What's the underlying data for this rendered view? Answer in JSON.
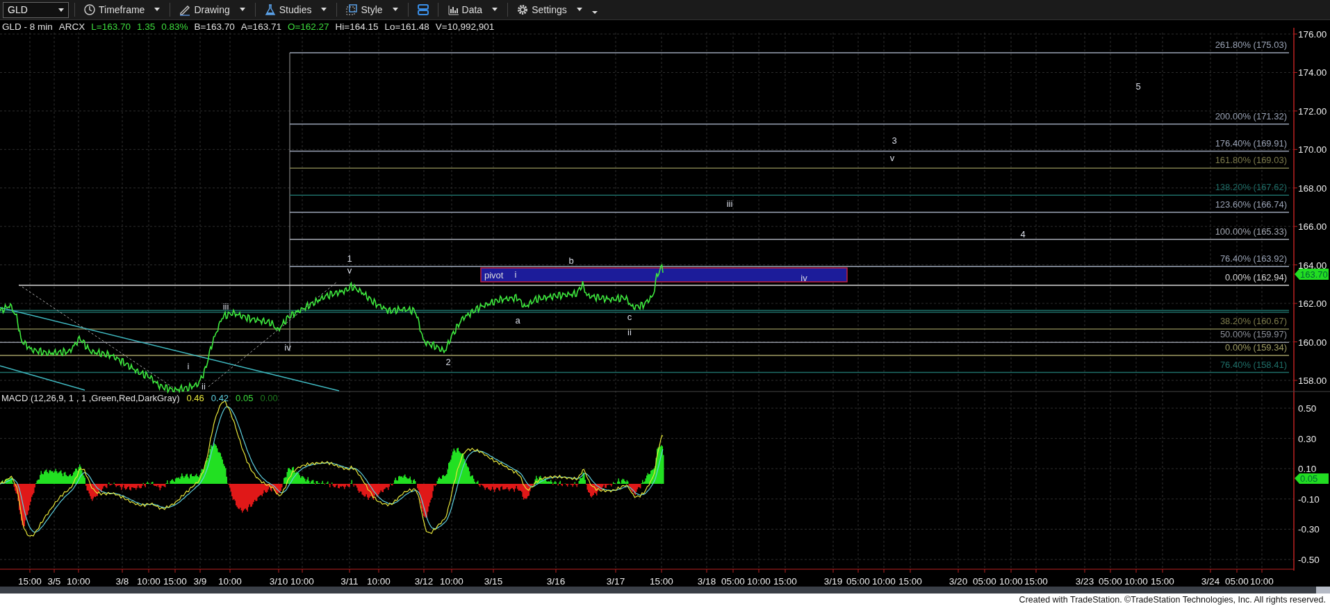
{
  "toolbar": {
    "symbol": "GLD",
    "menus": [
      {
        "kind": "menu",
        "label": "Timeframe"
      },
      {
        "kind": "menu",
        "label": "Drawing"
      },
      {
        "kind": "menu",
        "label": "Studies"
      },
      {
        "kind": "menu",
        "label": "Style"
      },
      {
        "kind": "icon"
      },
      {
        "kind": "menu",
        "label": "Data"
      },
      {
        "kind": "menu",
        "label": "Settings"
      }
    ]
  },
  "quote": [
    {
      "text": "GLD - 8 min",
      "color": "#e0e0e0"
    },
    {
      "text": "ARCX",
      "color": "#e0e0e0"
    },
    {
      "text": "L=163.70",
      "color": "#3ddc3d"
    },
    {
      "text": "1.35",
      "color": "#3ddc3d"
    },
    {
      "text": "0.83%",
      "color": "#3ddc3d"
    },
    {
      "text": "B=163.70",
      "color": "#e0e0e0"
    },
    {
      "text": "A=163.71",
      "color": "#e0e0e0"
    },
    {
      "text": "O=162.27",
      "color": "#3ddc3d"
    },
    {
      "text": "Hi=164.15",
      "color": "#e0e0e0"
    },
    {
      "text": "Lo=161.48",
      "color": "#e0e0e0"
    },
    {
      "text": "V=10,992,901",
      "color": "#e0e0e0"
    }
  ],
  "price_axis": [
    "176.00",
    "174.00",
    "172.00",
    "170.00",
    "168.00",
    "166.00",
    "164.00",
    "162.00",
    "160.00",
    "158.00"
  ],
  "last_price": "163.70",
  "fib_levels": [
    {
      "label": "261.80% (175.03)",
      "color": "#9aa3b5"
    },
    {
      "label": "200.00% (171.32)",
      "color": "#9aa3b5"
    },
    {
      "label": "176.40% (169.91)",
      "color": "#9aa3b5"
    },
    {
      "label": "161.80% (169.03)",
      "color": "#7d7b4c"
    },
    {
      "label": "138.20% (167.62)",
      "color": "#1e6e68"
    },
    {
      "label": "123.60% (166.74)",
      "color": "#9aa3b5"
    },
    {
      "label": "100.00% (165.33)",
      "color": "#a4a8b2"
    },
    {
      "label": "76.40% (163.92)",
      "color": "#9aa3b5"
    },
    {
      "label": "0.00% (162.94)",
      "color": "#d8d8d8"
    },
    {
      "label": "38.20% (160.67)",
      "color": "#7d7b4c"
    },
    {
      "label": "50.00% (159.97)",
      "color": "#8c909a"
    },
    {
      "label": "0.00% (159.34)",
      "color": "#a09d64"
    },
    {
      "label": "76.40% (158.41)",
      "color": "#1e6e68"
    }
  ],
  "wave_labels": [
    "1",
    "v",
    "iii",
    "iv",
    "i",
    "ii",
    "2",
    "i",
    "b",
    "a",
    "c",
    "ii",
    "iii",
    "3",
    "v",
    "iv",
    "4",
    "5"
  ],
  "pivot_zone": {
    "label": "pivot"
  },
  "macd": {
    "title": "MACD (12,26,9, 1 , 1 ,Green,Red,DarkGray)",
    "values": [
      {
        "text": "0.46",
        "color": "#e6e63a"
      },
      {
        "text": "0.42",
        "color": "#5fd0e0"
      },
      {
        "text": "0.05",
        "color": "#3ddc3d"
      },
      {
        "text": "0.00",
        "color": "#1f7a1f"
      }
    ],
    "axis": [
      "0.50",
      "0.30",
      "0.10",
      "-0.10",
      "-0.30",
      "-0.50"
    ],
    "last_value": "0.05"
  },
  "time_axis": [
    "15:00",
    "3/5",
    "10:00",
    "3/8",
    "10:00",
    "15:00",
    "3/9",
    "10:00",
    "3/10",
    "10:00",
    "3/11",
    "10:00",
    "3/12",
    "10:00",
    "3/15",
    "3/16",
    "3/17",
    "15:00",
    "3/18",
    "05:00",
    "10:00",
    "15:00",
    "3/19",
    "05:00",
    "10:00",
    "15:00",
    "3/20",
    "05:00",
    "10:00",
    "15:00",
    "3/23",
    "05:00",
    "10:00",
    "15:00",
    "3/24",
    "05:00",
    "10:00"
  ],
  "footer": "Created with TradeStation. ©TradeStation Technologies, Inc. All rights reserved."
}
